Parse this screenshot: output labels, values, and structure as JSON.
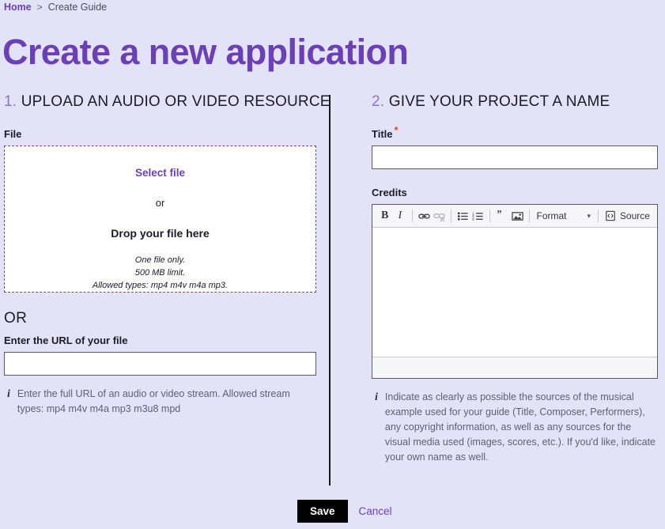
{
  "breadcrumb": {
    "home": "Home",
    "separator": ">",
    "current": "Create Guide"
  },
  "page": {
    "title": "Create a new application",
    "accent_color": "#6b3fb8",
    "background_color": "#e3e3f7"
  },
  "step_upload": {
    "number": "1.",
    "heading": "UPLOAD AN AUDIO OR VIDEO RESOURCE",
    "file_label": "File",
    "select_file": "Select file",
    "or_small": "or",
    "drop_text": "Drop your file here",
    "hint_one_file": "One file only.",
    "hint_limit": "500 MB limit.",
    "hint_types": "Allowed types: mp4 m4v m4a mp3.",
    "or_big": "OR",
    "url_label": "Enter the URL of your file",
    "url_value": "",
    "url_placeholder": "",
    "url_help": "Enter the full URL of an audio or video stream. Allowed stream types: mp4 m4v m4a mp3 m3u8 mpd"
  },
  "step_name": {
    "number": "2.",
    "heading": "GIVE YOUR PROJECT A NAME",
    "title_label": "Title",
    "required_marker": "*",
    "title_value": "",
    "title_placeholder": "",
    "credits_label": "Credits",
    "credits_value": "",
    "credits_help": "Indicate as clearly as possible the sources of the musical example used for your guide (Title, Composer, Performers), any copyright information, as well as any sources for the visual media used (images, scores, etc.). If you'd like, indicate your own name as well."
  },
  "editor_toolbar": {
    "bold": "B",
    "italic": "I",
    "link": "link-icon",
    "unlink": "unlink-icon",
    "bulleted_list": "bulleted-list-icon",
    "numbered_list": "numbered-list-icon",
    "blockquote": "”",
    "image": "image-icon",
    "format_label": "Format",
    "format_caret": "▾",
    "source_label": "Source"
  },
  "actions": {
    "save": "Save",
    "cancel": "Cancel"
  }
}
